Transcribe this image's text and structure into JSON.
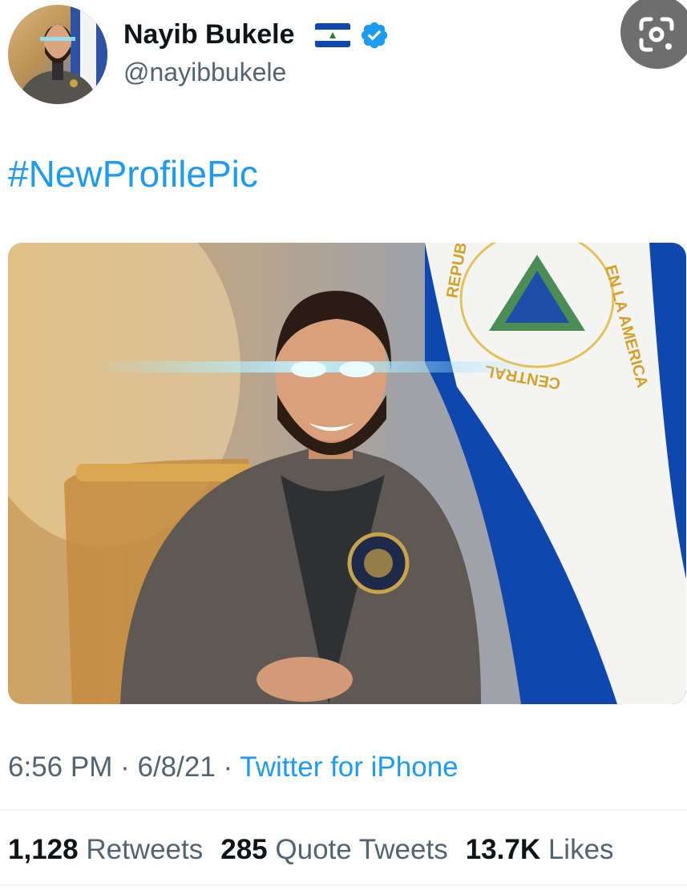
{
  "author": {
    "name": "Nayib Bukele",
    "handle": "@nayibbukele",
    "flag_icon": "el-salvador-flag-icon",
    "verified_icon": "verified-badge-icon"
  },
  "tweet": {
    "text": "#NewProfilePic",
    "time": "6:56 PM",
    "separator": "·",
    "date": "6/8/21",
    "source": "Twitter for iPhone"
  },
  "stats": {
    "retweets_count": "1,128",
    "retweets_label": "Retweets",
    "quotes_count": "285",
    "quotes_label": "Quote Tweets",
    "likes_count": "13.7K",
    "likes_label": "Likes"
  },
  "image": {
    "flag_text_top": "REPUB",
    "flag_text_right": "EN LA AMERICA",
    "flag_text_bottom": "CENTRAL"
  },
  "colors": {
    "link": "#1d9bf0",
    "secondary_text": "#536471",
    "verified": "#1d9bf0",
    "flag_blue": "#0f47af"
  },
  "icons": {
    "lens": "google-lens-icon"
  }
}
